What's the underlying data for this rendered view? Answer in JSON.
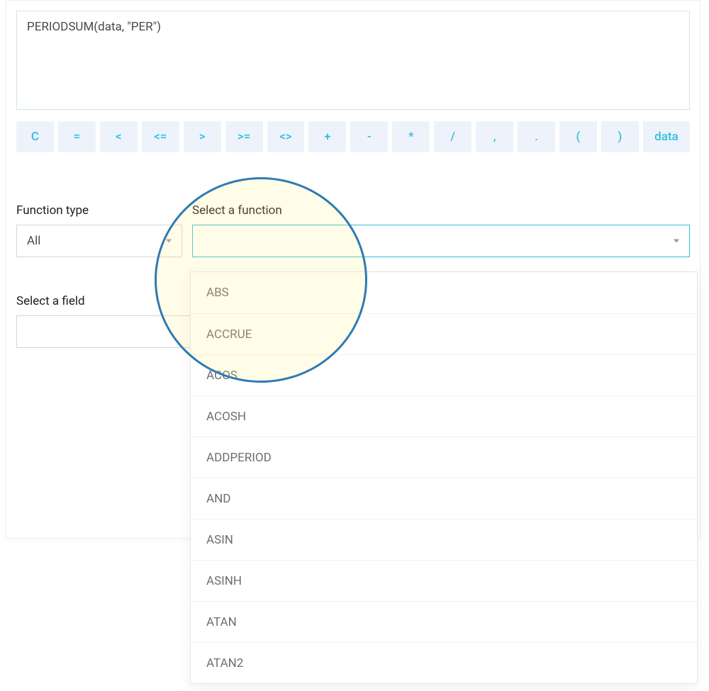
{
  "formula": "PERIODSUM(data, \"PER\")",
  "operators": [
    "C",
    "=",
    "<",
    "<=",
    ">",
    ">=",
    "<>",
    "+",
    "-",
    "*",
    "/",
    ",",
    ".",
    "(",
    ")",
    "data"
  ],
  "labels": {
    "function_type": "Function type",
    "select_function": "Select a function",
    "select_field": "Select a field"
  },
  "function_type_value": "All",
  "select_function_value": "",
  "function_options": [
    "ABS",
    "ACCRUE",
    "ACOS",
    "ACOSH",
    "ADDPERIOD",
    "AND",
    "ASIN",
    "ASINH",
    "ATAN",
    "ATAN2"
  ]
}
